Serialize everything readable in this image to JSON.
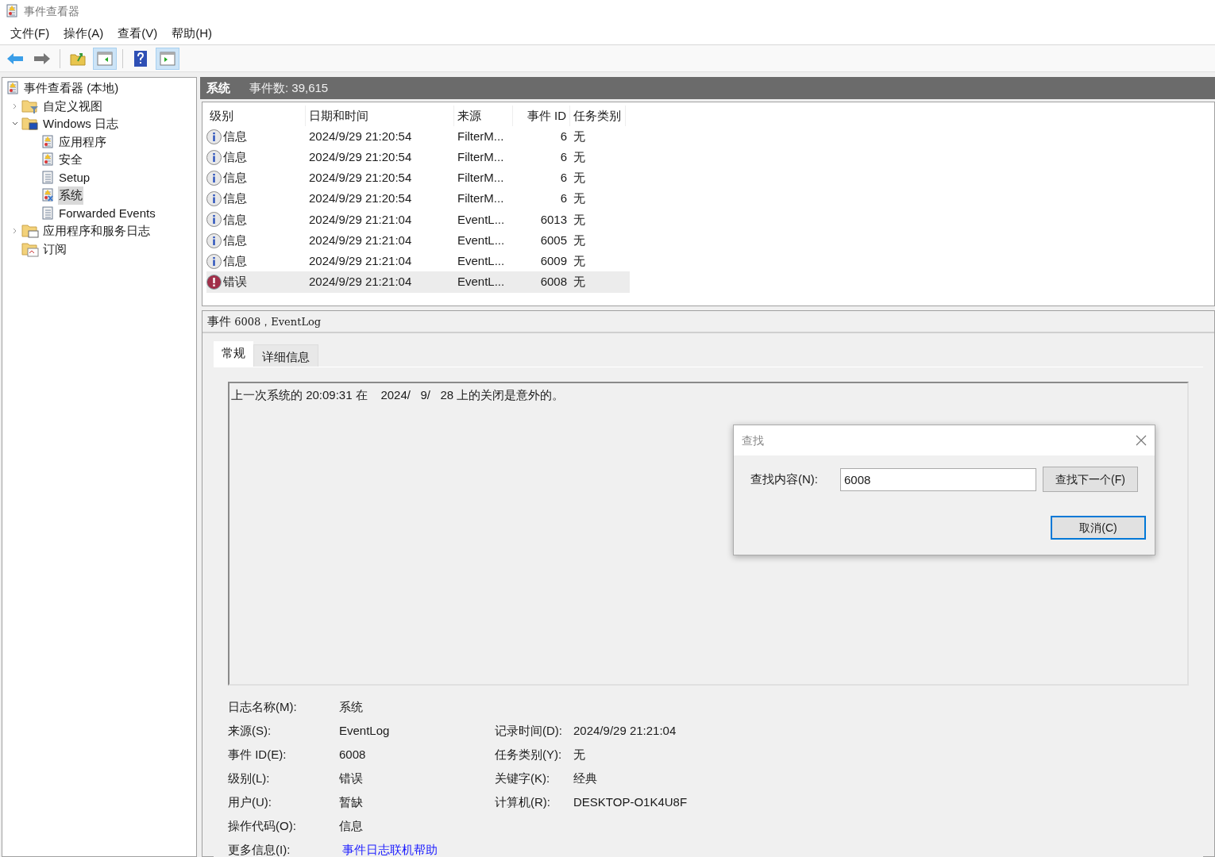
{
  "window": {
    "title": "事件查看器"
  },
  "menu": [
    "文件(F)",
    "操作(A)",
    "查看(V)",
    "帮助(H)"
  ],
  "toolbar": [
    {
      "kind": "back",
      "pressed": false
    },
    {
      "kind": "forward",
      "pressed": false
    },
    {
      "kind": "up",
      "pressed": false
    },
    {
      "kind": "tree",
      "pressed": true
    },
    {
      "kind": "help",
      "pressed": false
    },
    {
      "kind": "actions",
      "pressed": true
    }
  ],
  "tree": [
    {
      "label": "事件查看器 (本地)",
      "kind": "root",
      "selected": false,
      "children": [
        {
          "label": "自定义视图",
          "kind": "folder-filter",
          "expanded": false,
          "selected": false
        },
        {
          "label": "Windows 日志",
          "kind": "folder-monitor",
          "expanded": true,
          "selected": false,
          "children": [
            {
              "label": "应用程序",
              "kind": "log-warn",
              "selected": false
            },
            {
              "label": "安全",
              "kind": "log-warn",
              "selected": false
            },
            {
              "label": "Setup",
              "kind": "log",
              "selected": false
            },
            {
              "label": "系统",
              "kind": "log-system",
              "selected": true
            },
            {
              "label": "Forwarded Events",
              "kind": "log",
              "selected": false
            }
          ]
        },
        {
          "label": "应用程序和服务日志",
          "kind": "folder-window",
          "expanded": false,
          "selected": false
        },
        {
          "label": "订阅",
          "kind": "folder-calendar",
          "selected": false
        }
      ]
    }
  ],
  "log_header": {
    "name": "系统",
    "count": "事件数: 39,615"
  },
  "table": {
    "columns": [
      "级别",
      "日期和时间",
      "来源",
      "事件 ID",
      "任务类别"
    ],
    "rows": [
      {
        "kind": "info",
        "level": "信息",
        "datetime": "2024/9/29 21:20:54",
        "source": "FilterM...",
        "event_id": "6",
        "category": "无",
        "selected": false
      },
      {
        "kind": "info",
        "level": "信息",
        "datetime": "2024/9/29 21:20:54",
        "source": "FilterM...",
        "event_id": "6",
        "category": "无",
        "selected": false
      },
      {
        "kind": "info",
        "level": "信息",
        "datetime": "2024/9/29 21:20:54",
        "source": "FilterM...",
        "event_id": "6",
        "category": "无",
        "selected": false
      },
      {
        "kind": "info",
        "level": "信息",
        "datetime": "2024/9/29 21:20:54",
        "source": "FilterM...",
        "event_id": "6",
        "category": "无",
        "selected": false
      },
      {
        "kind": "info",
        "level": "信息",
        "datetime": "2024/9/29 21:21:04",
        "source": "EventL...",
        "event_id": "6013",
        "category": "无",
        "selected": false
      },
      {
        "kind": "info",
        "level": "信息",
        "datetime": "2024/9/29 21:21:04",
        "source": "EventL...",
        "event_id": "6005",
        "category": "无",
        "selected": false
      },
      {
        "kind": "info",
        "level": "信息",
        "datetime": "2024/9/29 21:21:04",
        "source": "EventL...",
        "event_id": "6009",
        "category": "无",
        "selected": false
      },
      {
        "kind": "error",
        "level": "错误",
        "datetime": "2024/9/29 21:21:04",
        "source": "EventL...",
        "event_id": "6008",
        "category": "无",
        "selected": true
      }
    ]
  },
  "event_header": {
    "label": "事件",
    "title": "6008，EventLog"
  },
  "tabs": [
    {
      "label": "常规",
      "selected": true
    },
    {
      "label": "详细信息",
      "selected": false
    }
  ],
  "description": "上一次系统的 20:09:31 在    2024/   9/   28 上的关闭是意外的。",
  "properties_left": [
    {
      "label": "日志名称(M):",
      "value": "系统"
    },
    {
      "label": "来源(S):",
      "value": "EventLog"
    },
    {
      "label": "事件 ID(E):",
      "value": "6008"
    },
    {
      "label": "级别(L):",
      "value": "错误"
    },
    {
      "label": "用户(U):",
      "value": "暂缺"
    },
    {
      "label": "操作代码(O):",
      "value": "信息"
    },
    {
      "label": "更多信息(I):",
      "value": "事件日志联机帮助",
      "kind": "link"
    }
  ],
  "properties_right": [
    {
      "label": "记录时间(D):",
      "value": "2024/9/29 21:21:04"
    },
    {
      "label": "任务类别(Y):",
      "value": "无"
    },
    {
      "label": "关键字(K):",
      "value": "经典"
    },
    {
      "label": "计算机(R):",
      "value": "DESKTOP-O1K4U8F"
    }
  ],
  "find_dialog": {
    "title": "查找",
    "label": "查找内容(N):",
    "value": "6008",
    "buttons": [
      {
        "label": "查找下一个(F)",
        "focused": false
      },
      {
        "label": "取消(C)",
        "focused": true
      }
    ]
  }
}
